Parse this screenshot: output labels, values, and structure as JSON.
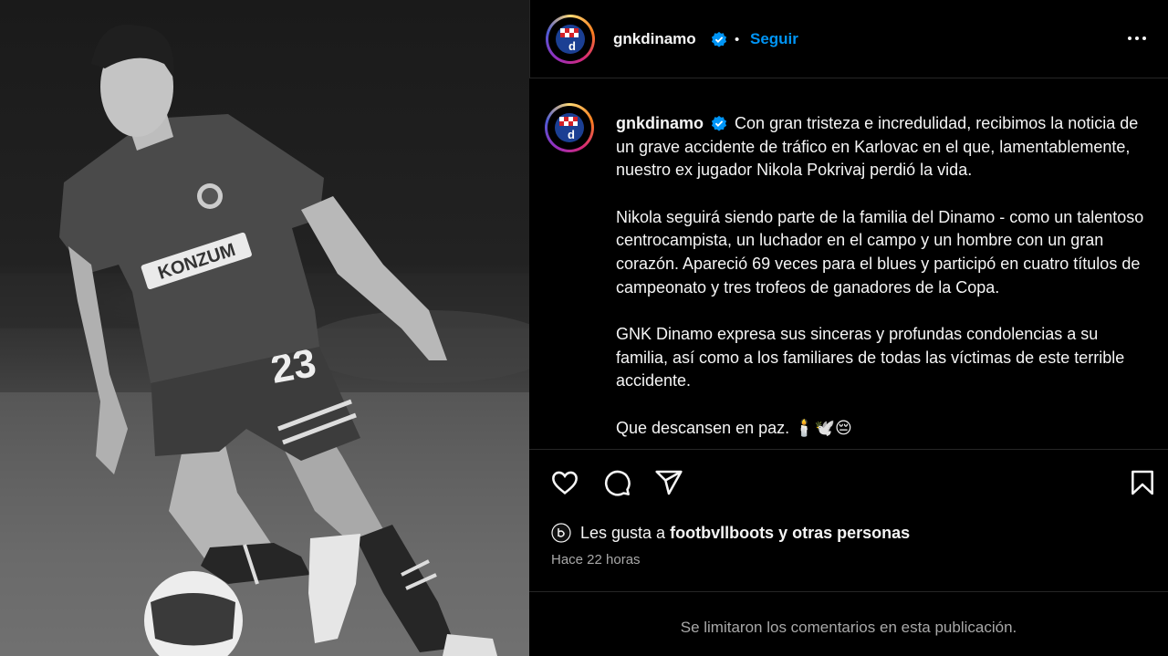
{
  "post": {
    "username": "gnkdinamo",
    "follow_label": "Seguir",
    "dot": "•",
    "caption": {
      "p1": "Con gran tristeza e incredulidad, recibimos la noticia de un grave accidente de tráfico en Karlovac en el que, lamentablemente, nuestro ex jugador Nikola Pokrivaj perdió la vida.",
      "p2": "Nikola seguirá siendo parte de la familia del Dinamo - como un talentoso centrocampista, un luchador en el campo y un hombre con un gran corazón. Apareció 69 veces para el blues y participó en cuatro títulos de campeonato y tres trofeos de ganadores de la Copa.",
      "p3": "GNK Dinamo expresa sus sinceras y profundas condolencias a su familia, así como a los familiares de todas las víctimas de este terrible accidente.",
      "p4": "Que descansen en paz. 🕯️🕊️😔"
    },
    "likes": {
      "prefix": "Les gusta a",
      "user": "footbvllboots",
      "suffix": "y otras personas"
    },
    "timestamp": "Hace 22 horas",
    "comments_notice": "Se limitaron los comentarios en esta publicación."
  },
  "photo": {
    "sponsor": "KONZUM",
    "shirt_number": "23"
  },
  "icons": {
    "avatar": "dinamo-crest-icon",
    "verified": "verified-badge-icon",
    "more": "more-options-icon",
    "like": "heart-icon",
    "comment": "comment-bubble-icon",
    "share": "paper-plane-icon",
    "save": "bookmark-icon",
    "likes_avatar": "liker-avatar-icon"
  },
  "colors": {
    "accent": "#0095f6",
    "background": "#000000",
    "muted": "#a8a8a8",
    "verified": "#0095f6"
  }
}
